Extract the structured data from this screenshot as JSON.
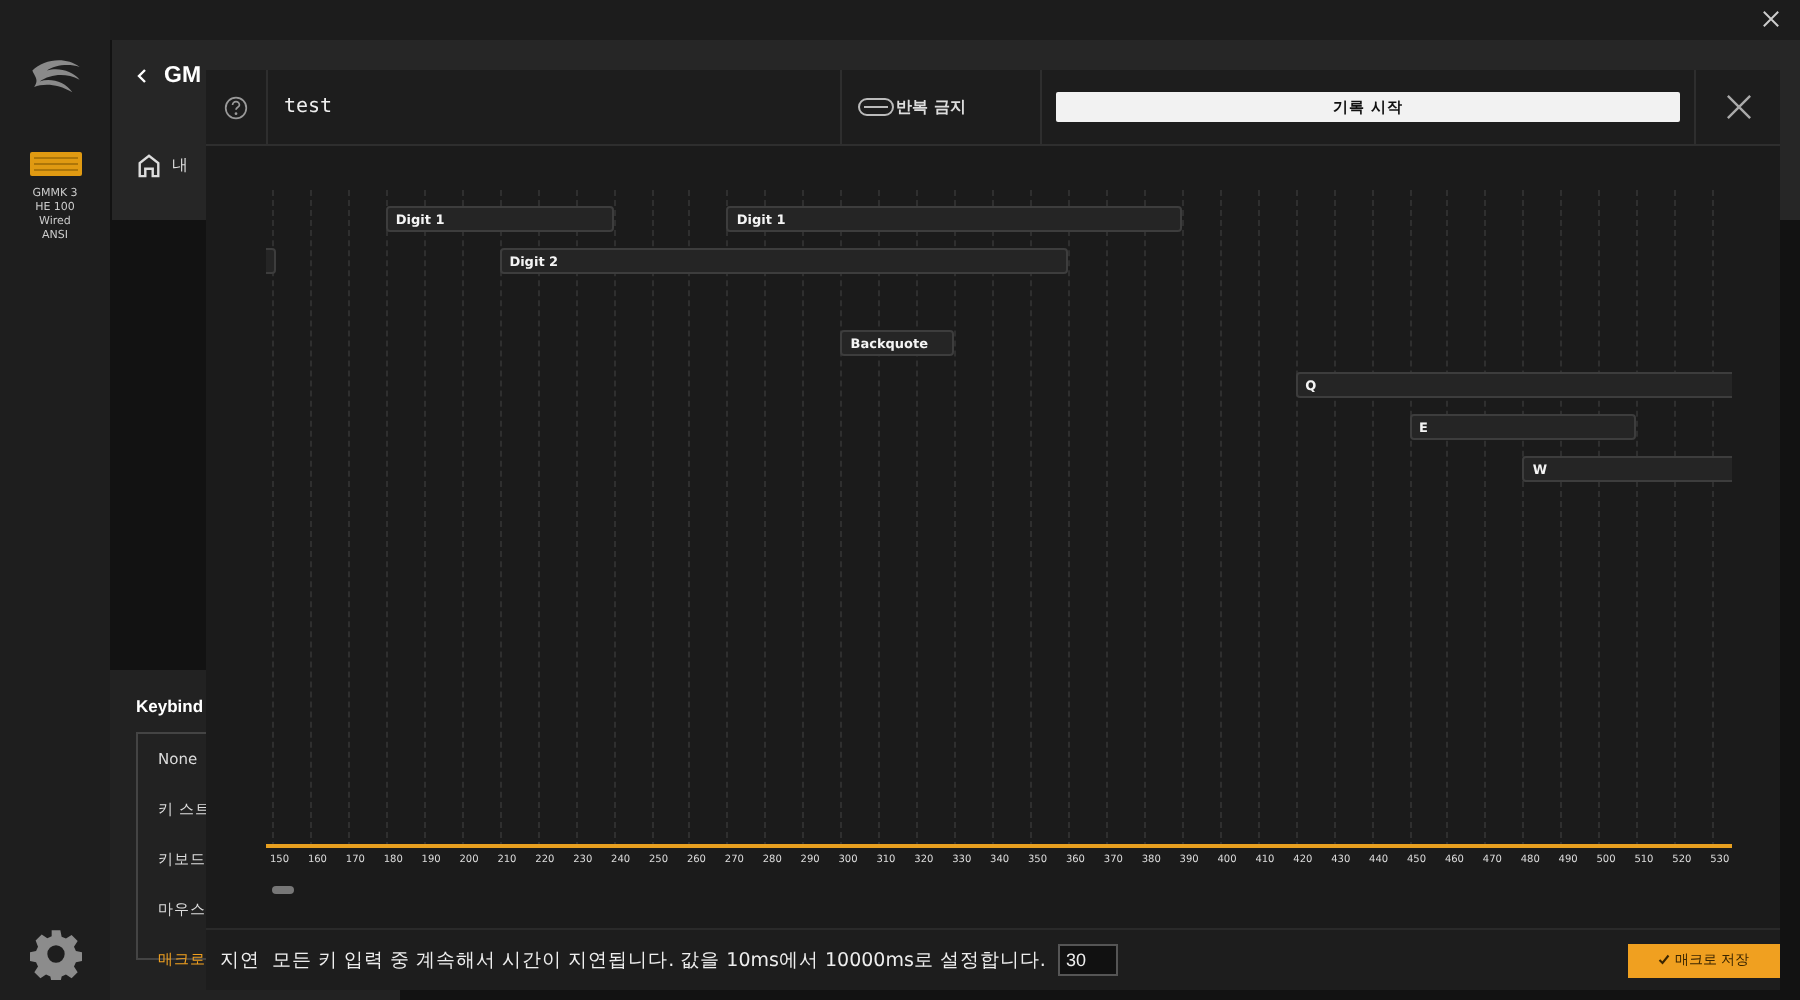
{
  "sidebar": {
    "device_name": "GMMK 3\nHE 100\nWired\nANSI",
    "device_selected": true
  },
  "background_panel": {
    "title": "GM",
    "home_label": "내"
  },
  "keybind": {
    "title": "Keybind",
    "items": [
      {
        "label": "None",
        "selected": false
      },
      {
        "label": "키 스트",
        "selected": false
      },
      {
        "label": "키보드",
        "selected": false
      },
      {
        "label": "마우스",
        "selected": false
      },
      {
        "label": "매크로",
        "selected": true
      }
    ]
  },
  "macro_editor": {
    "name": "test",
    "repeat": {
      "label": "반복 금지",
      "on": false
    },
    "record_button": "기록 시작",
    "events": [
      {
        "kind": "key",
        "label": "Digit 1"
      },
      {
        "kind": "key",
        "label": "Digit 1"
      },
      {
        "kind": "clipped"
      },
      {
        "kind": "key",
        "label": "Digit 2"
      },
      {
        "kind": "key",
        "label": "Backquote"
      },
      {
        "kind": "key",
        "label": "Q"
      },
      {
        "kind": "key",
        "label": "E"
      },
      {
        "kind": "key",
        "label": "W"
      }
    ],
    "ticks": [
      "150",
      "160",
      "170",
      "180",
      "190",
      "200",
      "210",
      "220",
      "230",
      "240",
      "250",
      "260",
      "270",
      "280",
      "290",
      "300",
      "310",
      "320",
      "330",
      "340",
      "350",
      "360",
      "370",
      "380",
      "390",
      "400",
      "410",
      "420",
      "430",
      "440",
      "450",
      "460",
      "470",
      "480",
      "490",
      "500",
      "510",
      "520",
      "530"
    ],
    "delay": {
      "label": "지연",
      "description": "모든 키 입력 중 계속해서 시간이 지연됩니다. 값을 10ms에서 10000ms로 설정합니다.",
      "value": "30"
    },
    "save_button": "매크로 저장"
  }
}
